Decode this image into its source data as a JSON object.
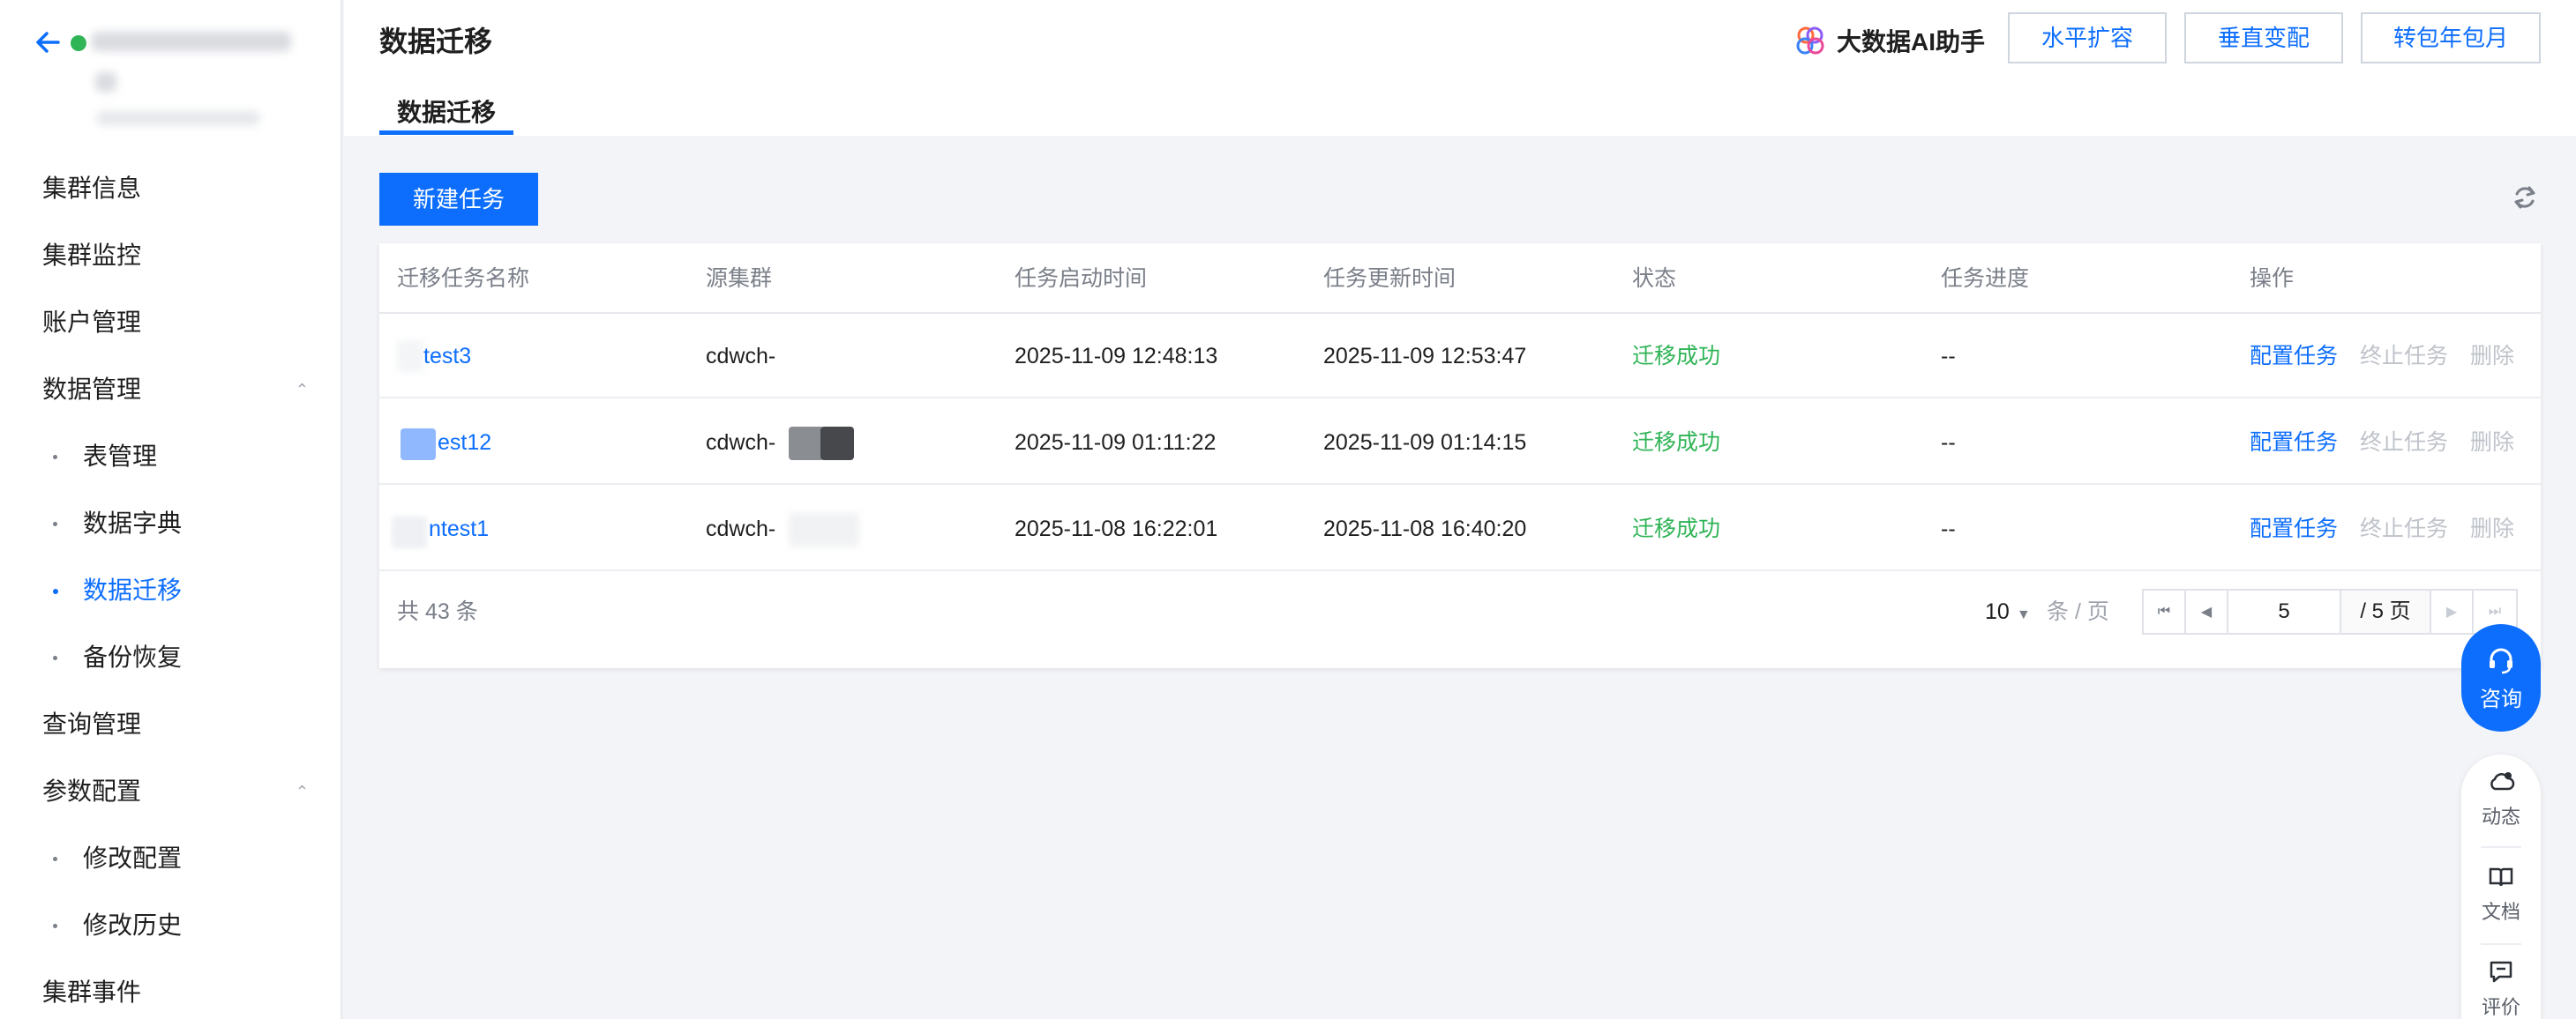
{
  "sidebar": {
    "nav": [
      {
        "label": "集群信息",
        "type": "item"
      },
      {
        "label": "集群监控",
        "type": "item"
      },
      {
        "label": "账户管理",
        "type": "item"
      },
      {
        "label": "数据管理",
        "type": "group",
        "expanded": true
      },
      {
        "label": "表管理",
        "type": "sub"
      },
      {
        "label": "数据字典",
        "type": "sub"
      },
      {
        "label": "数据迁移",
        "type": "sub",
        "active": true
      },
      {
        "label": "备份恢复",
        "type": "sub"
      },
      {
        "label": "查询管理",
        "type": "item"
      },
      {
        "label": "参数配置",
        "type": "group",
        "expanded": true
      },
      {
        "label": "修改配置",
        "type": "sub"
      },
      {
        "label": "修改历史",
        "type": "sub"
      },
      {
        "label": "集群事件",
        "type": "item"
      }
    ]
  },
  "header": {
    "title": "数据迁移",
    "ai_assistant": "大数据AI助手",
    "buttons": [
      "水平扩容",
      "垂直变配",
      "转包年包月"
    ],
    "tab": "数据迁移"
  },
  "toolbar": {
    "new_task": "新建任务"
  },
  "table": {
    "columns": [
      "迁移任务名称",
      "源集群",
      "任务启动时间",
      "任务更新时间",
      "状态",
      "任务进度",
      "操作"
    ],
    "rows": [
      {
        "name": "test3",
        "source": "cdwch-",
        "start": "2025-11-09 12:48:13",
        "update": "2025-11-09 12:53:47",
        "status": "迁移成功",
        "progress": "--"
      },
      {
        "name": "est12",
        "source": "cdwch-",
        "start": "2025-11-09 01:11:22",
        "update": "2025-11-09 01:14:15",
        "status": "迁移成功",
        "progress": "--"
      },
      {
        "name": "ntest1",
        "source": "cdwch-",
        "start": "2025-11-08 16:22:01",
        "update": "2025-11-08 16:40:20",
        "status": "迁移成功",
        "progress": "--"
      }
    ],
    "actions": {
      "config": "配置任务",
      "stop": "终止任务",
      "delete": "删除"
    }
  },
  "pagination": {
    "total_text": "共 43 条",
    "page_size": "10",
    "per_page": "条 / 页",
    "current_page": "5",
    "total_pages": "/ 5 页"
  },
  "floating": {
    "consult": "咨询",
    "tools": [
      "动态",
      "文档",
      "评价"
    ]
  },
  "colors": {
    "accent": "#0d6efd",
    "success": "#2fb456",
    "disabled": "#bfc3ca"
  }
}
